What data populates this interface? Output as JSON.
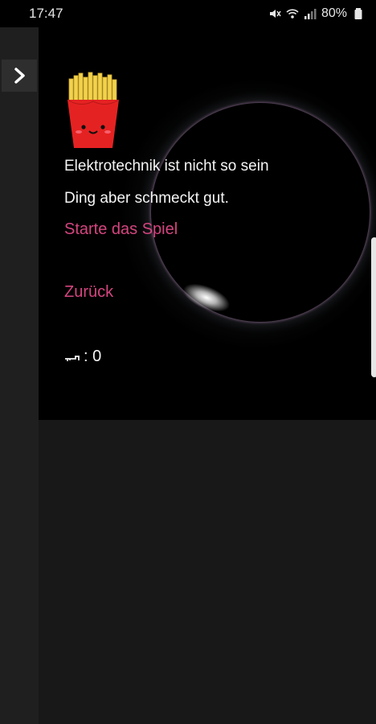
{
  "status_bar": {
    "time": "17:47",
    "battery": "80%",
    "icons": [
      "mute-icon",
      "wifi-icon",
      "signal-icon",
      "battery-icon"
    ]
  },
  "sidebar": {
    "toggle_icon": "chevron-right-icon"
  },
  "character": {
    "avatar_icon": "fries-character-icon",
    "description_line1": "Elektrotechnik ist nicht so sein",
    "description_line2": "Ding aber schmeckt gut."
  },
  "actions": {
    "start_game": "Starte das Spiel",
    "back": "Zurück"
  },
  "keys": {
    "icon": "key-icon",
    "label": ": 0"
  },
  "colors": {
    "accent": "#d4457f",
    "background": "#000000",
    "sidebar": "#1f1f1f"
  }
}
